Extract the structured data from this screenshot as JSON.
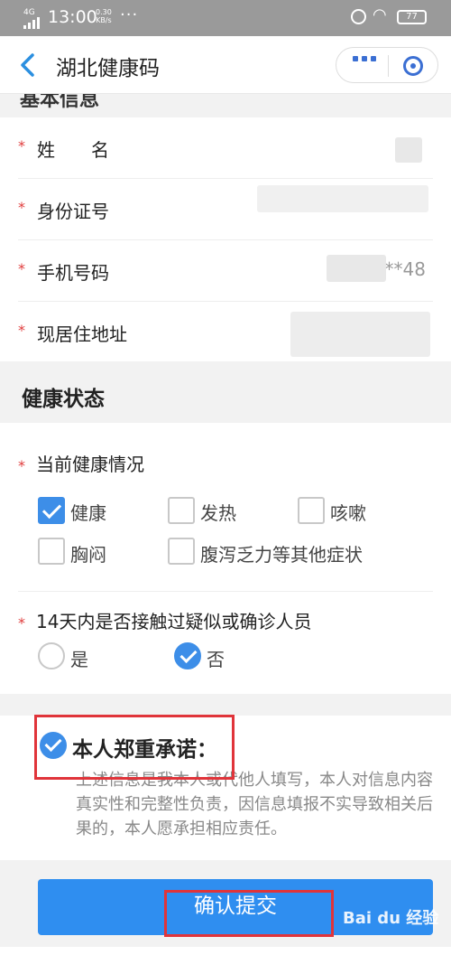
{
  "status_bar": {
    "network": "4G",
    "time": "13:00",
    "speed_top": "0.30",
    "speed_bottom": "KB/s",
    "more": "···",
    "battery": "77"
  },
  "navbar": {
    "title": "湖北健康码"
  },
  "section_prev": {
    "title_cut": "基本信息"
  },
  "personal_fields": [
    {
      "label": "姓　　名",
      "value": ""
    },
    {
      "label": "身份证号",
      "value": ""
    },
    {
      "label": "手机号码",
      "value": "**48"
    },
    {
      "label": "现居住地址",
      "value": ""
    }
  ],
  "health_section": {
    "title": "健康状态",
    "q1": {
      "label": "当前健康情况",
      "options": [
        {
          "label": "健康",
          "checked": true
        },
        {
          "label": "发热",
          "checked": false
        },
        {
          "label": "咳嗽",
          "checked": false
        },
        {
          "label": "胸闷",
          "checked": false
        },
        {
          "label": "腹泻乏力等其他症状",
          "checked": false
        }
      ]
    },
    "q2": {
      "label": "14天内是否接触过疑似或确诊人员",
      "options": [
        {
          "label": "是",
          "checked": false
        },
        {
          "label": "否",
          "checked": true
        }
      ]
    }
  },
  "pledge": {
    "title": "本人郑重承诺：",
    "checked": true,
    "text": "上述信息是我本人或代他人填写，本人对信息内容真实性和完整性负责，因信息填报不实导致相关后果的，本人愿承担相应责任。"
  },
  "submit": {
    "label": "确认提交"
  },
  "watermark": "Bai du 经验",
  "colors": {
    "accent": "#2f8ef0",
    "required": "#e03c3c",
    "annotation": "#e0343a"
  }
}
